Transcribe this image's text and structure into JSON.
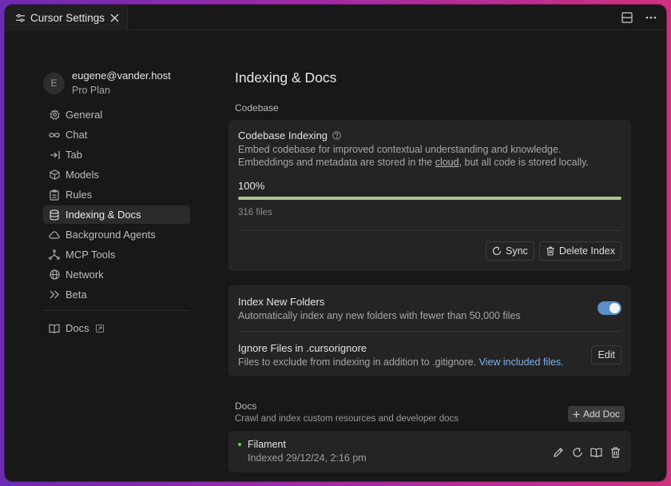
{
  "tab": {
    "title": "Cursor Settings"
  },
  "sidebar": {
    "account": {
      "avatar_letter": "E",
      "email": "eugene@vander.host",
      "plan": "Pro Plan"
    },
    "items": [
      {
        "label": "General",
        "icon": "gear-icon"
      },
      {
        "label": "Chat",
        "icon": "infinity-icon"
      },
      {
        "label": "Tab",
        "icon": "tab-arrow-icon"
      },
      {
        "label": "Models",
        "icon": "cube-icon"
      },
      {
        "label": "Rules",
        "icon": "clipboard-icon"
      },
      {
        "label": "Indexing & Docs",
        "icon": "database-icon",
        "active": true
      },
      {
        "label": "Background Agents",
        "icon": "cloud-icon"
      },
      {
        "label": "MCP Tools",
        "icon": "nodes-icon"
      },
      {
        "label": "Network",
        "icon": "globe-icon"
      },
      {
        "label": "Beta",
        "icon": "chevrons-right-icon"
      }
    ],
    "docs_link": {
      "label": "Docs",
      "icon": "book-icon"
    }
  },
  "main": {
    "title": "Indexing & Docs",
    "codebase_section": "Codebase",
    "indexing": {
      "title": "Codebase Indexing",
      "desc_line1": "Embed codebase for improved contextual understanding and knowledge.",
      "desc_line2_prefix": "Embeddings and metadata are stored in the ",
      "desc_line2_link": "cloud",
      "desc_line2_suffix": ", but all code is stored locally.",
      "progress_label": "100%",
      "progress_value": 1.0,
      "files": "316 files",
      "sync_label": "Sync",
      "delete_label": "Delete Index"
    },
    "folders": {
      "title": "Index New Folders",
      "desc": "Automatically index any new folders with fewer than 50,000 files",
      "toggle_on": true
    },
    "ignore": {
      "title": "Ignore Files in .cursorignore",
      "desc_prefix": "Files to exclude from indexing in addition to .gitignore. ",
      "desc_link": "View included files.",
      "edit_label": "Edit"
    },
    "docs": {
      "title": "Docs",
      "subtitle": "Crawl and index custom resources and developer docs",
      "add_label": "Add Doc",
      "items": [
        {
          "name": "Filament",
          "meta": "Indexed 29/12/24, 2:16 pm",
          "status_color": "#6ec56e"
        }
      ]
    }
  },
  "colors": {
    "accent": "#5b8fc7",
    "progress": "#a9c48b",
    "link": "#7fb0e6"
  }
}
